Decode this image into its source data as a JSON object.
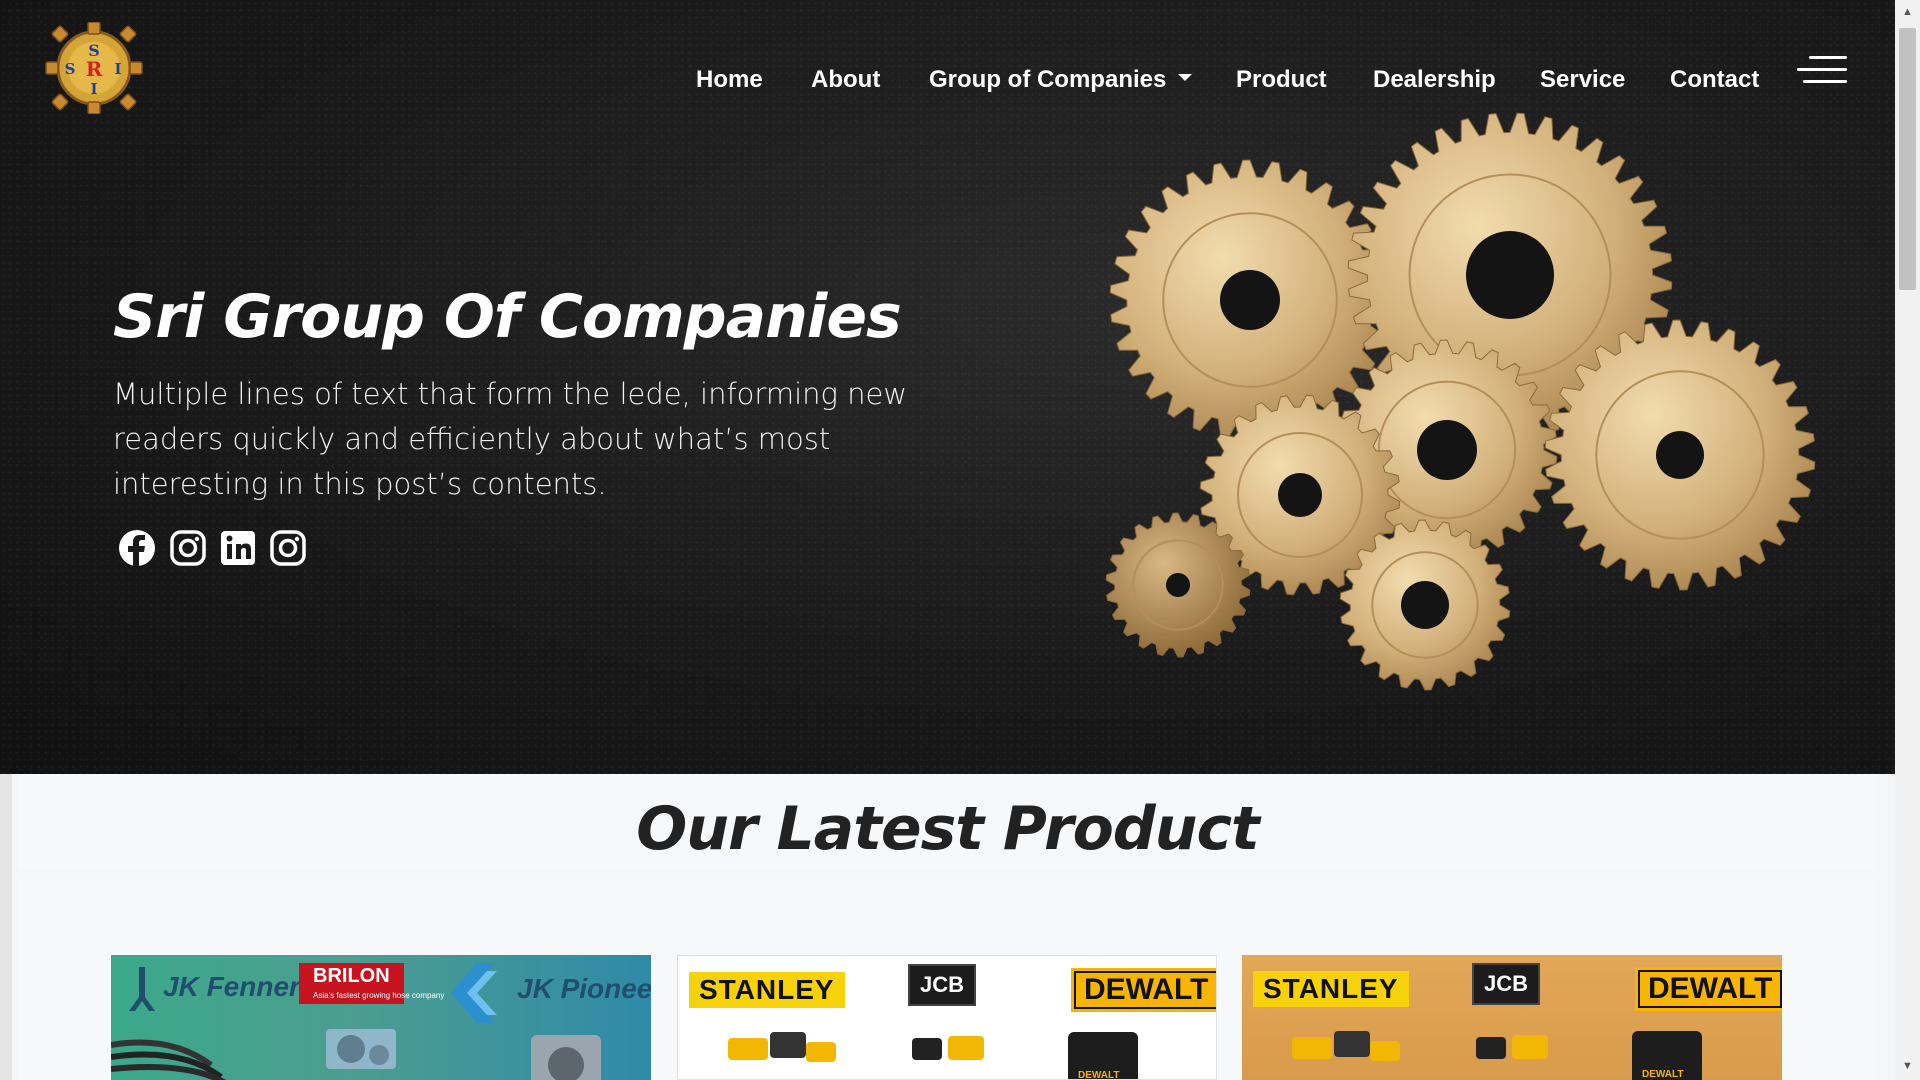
{
  "nav": {
    "items": [
      {
        "label": "Home"
      },
      {
        "label": "About"
      },
      {
        "label": "Group of Companies"
      },
      {
        "label": "Product"
      },
      {
        "label": "Dealership"
      },
      {
        "label": "Service"
      },
      {
        "label": "Contact"
      }
    ]
  },
  "logo": {
    "letters": [
      "S",
      "R",
      "I",
      "S",
      "I"
    ]
  },
  "hero": {
    "title": "Sri Group Of Companies",
    "lede": "Multiple lines of text that form the lede, informing new readers quickly and efficiently about what’s most interesting in this post’s contents.",
    "socials": [
      {
        "icon": "facebook-icon"
      },
      {
        "icon": "instagram-icon"
      },
      {
        "icon": "linkedin-icon"
      },
      {
        "icon": "instagram-icon"
      }
    ]
  },
  "latest": {
    "title": "Our Latest Product",
    "cards": [
      {
        "brands": [
          "JK Fenner",
          "BRILON",
          "JK Pioneer"
        ],
        "brilon_tagline": "Asia's fastest growing hose company"
      },
      {
        "brands": [
          "STANLEY",
          "JCB",
          "DEWALT"
        ],
        "product_label": "DEWALT"
      },
      {
        "brands": [
          "STANLEY",
          "JCB",
          "DEWALT"
        ],
        "product_label": "DEWALT"
      }
    ]
  },
  "colors": {
    "hero_bg": "#1a1a1a",
    "gear": "#c9a66b",
    "stanley_yellow": "#f7d10a",
    "dewalt_yellow": "#f7b400",
    "brilon_red": "#c7131f",
    "card1_green": "#3ba88a",
    "card3_orange": "#e3a758"
  }
}
